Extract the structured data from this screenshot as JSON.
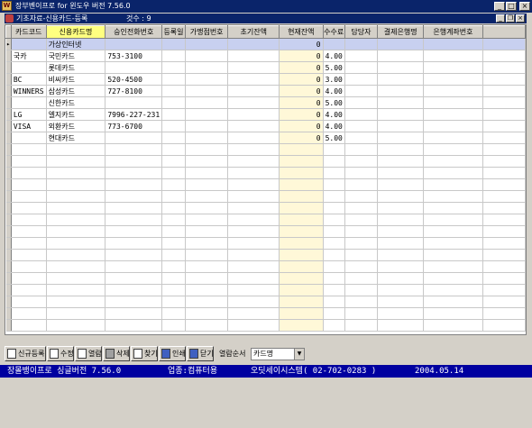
{
  "window": {
    "title": "장부벤이프로 for 윈도우 버전 7.56.0",
    "app_icon": "W"
  },
  "form": {
    "title": "기초자료-신용카드-등록",
    "count_label": "것수 : 9"
  },
  "grid": {
    "columns": [
      "카드코드",
      "신용카드명",
      "승인전화번호",
      "등록일",
      "가맹점번호",
      "초기잔액",
      "현재잔액",
      "수수료",
      "담당자",
      "결제은행명",
      "은행계좌번호"
    ],
    "rows": [
      {
        "code": "",
        "name": "가상인터넷",
        "phone": "",
        "date": "",
        "merchant": "",
        "initial": "",
        "current": "0",
        "fee": "",
        "manager": "",
        "bank": "",
        "account": ""
      },
      {
        "code": "국카",
        "name": "국민카드",
        "phone": "753-3100",
        "date": "",
        "merchant": "",
        "initial": "",
        "current": "0",
        "fee": "4.00",
        "manager": "",
        "bank": "",
        "account": ""
      },
      {
        "code": "",
        "name": "롯데카드",
        "phone": "",
        "date": "",
        "merchant": "",
        "initial": "",
        "current": "0",
        "fee": "5.00",
        "manager": "",
        "bank": "",
        "account": ""
      },
      {
        "code": "BC",
        "name": "비씨카드",
        "phone": "520-4500",
        "date": "",
        "merchant": "",
        "initial": "",
        "current": "0",
        "fee": "3.00",
        "manager": "",
        "bank": "",
        "account": ""
      },
      {
        "code": "WINNERS",
        "name": "삼성카드",
        "phone": "727-8100",
        "date": "",
        "merchant": "",
        "initial": "",
        "current": "0",
        "fee": "4.00",
        "manager": "",
        "bank": "",
        "account": ""
      },
      {
        "code": "",
        "name": "신한카드",
        "phone": "",
        "date": "",
        "merchant": "",
        "initial": "",
        "current": "0",
        "fee": "5.00",
        "manager": "",
        "bank": "",
        "account": ""
      },
      {
        "code": "LG",
        "name": "엘지카드",
        "phone": "7996-227-231",
        "date": "",
        "merchant": "",
        "initial": "",
        "current": "0",
        "fee": "4.00",
        "manager": "",
        "bank": "",
        "account": ""
      },
      {
        "code": "VISA",
        "name": "외환카드",
        "phone": "773-6700",
        "date": "",
        "merchant": "",
        "initial": "",
        "current": "0",
        "fee": "4.00",
        "manager": "",
        "bank": "",
        "account": ""
      },
      {
        "code": "",
        "name": "현대카드",
        "phone": "",
        "date": "",
        "merchant": "",
        "initial": "",
        "current": "0",
        "fee": "5.00",
        "manager": "",
        "bank": "",
        "account": ""
      }
    ],
    "row_indicator": "▸"
  },
  "toolbar": {
    "new_label": "신규등록",
    "edit_label": "수정",
    "view_label": "열람",
    "delete_label": "삭제",
    "find_label": "찾기",
    "print_label": "인쇄",
    "close_label": "닫기",
    "sort_label": "열람순서",
    "sort_value": "카드명"
  },
  "status": {
    "version": "장몰뱅이프로 싱글버전 7.56.0",
    "business": "업종:컴퓨터용",
    "company": "오딧세이시스템( 02-702-0283 )",
    "date": "2004.05.14"
  },
  "colors": {
    "titlebar": "#0a246a",
    "statusbar": "#0000a0",
    "header_highlight": "#ffff80",
    "selected_row": "#c8d0f0"
  },
  "icons": {
    "window_controls": [
      "minimize-icon",
      "maximize-icon",
      "close-icon"
    ],
    "toolbar": [
      "new-doc-icon",
      "edit-icon",
      "view-icon",
      "delete-icon",
      "find-icon",
      "print-icon",
      "close-door-icon"
    ]
  }
}
